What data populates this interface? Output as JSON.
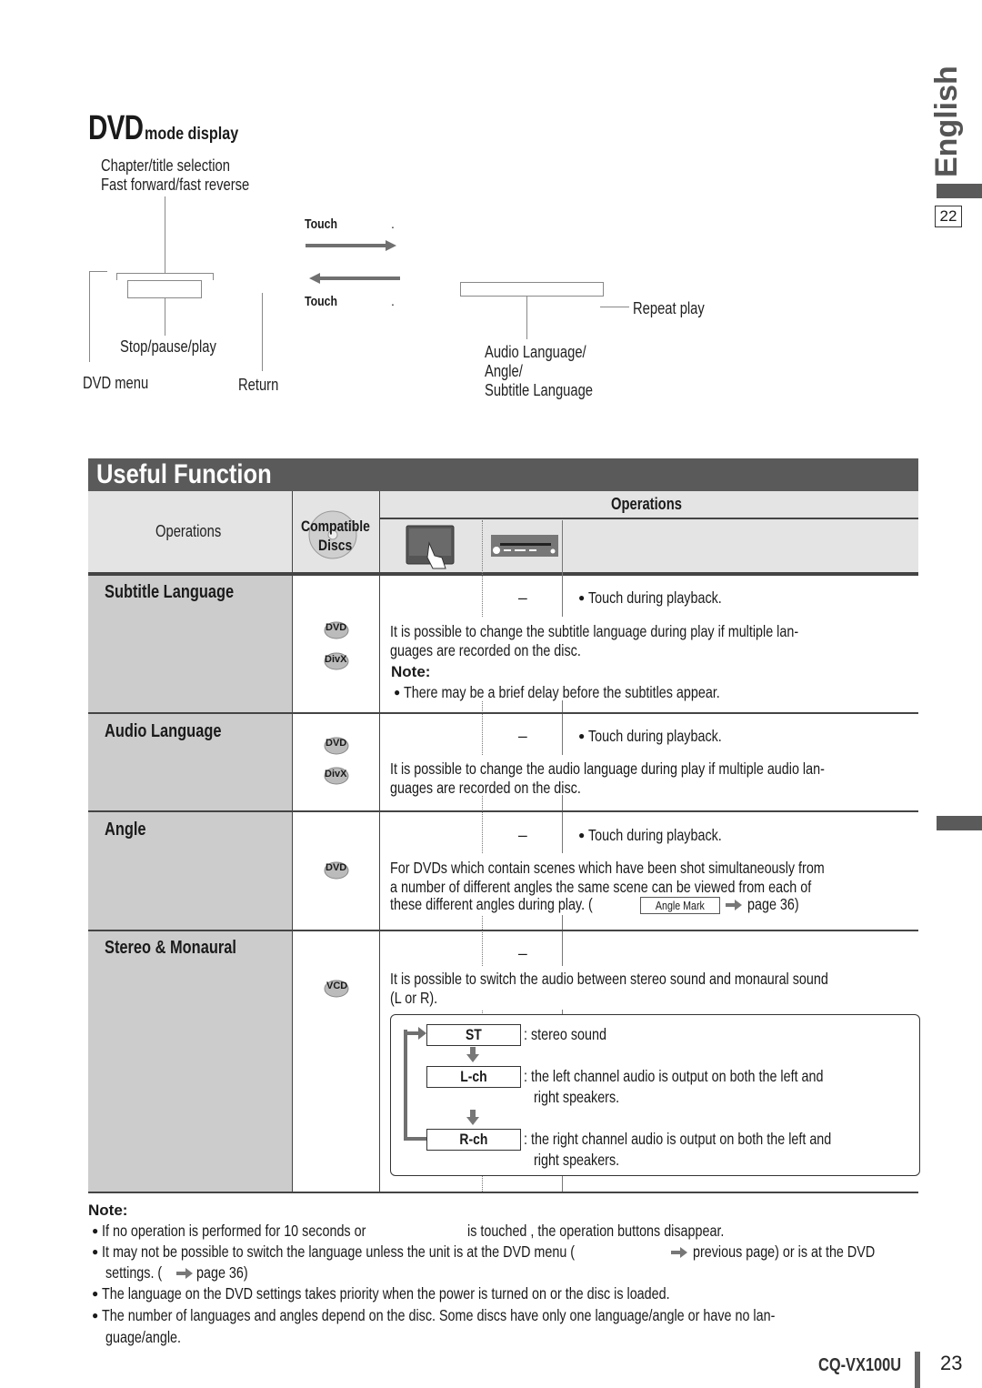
{
  "side_tab": {
    "language": "English",
    "page_ref": "22"
  },
  "dvd_mode_display": {
    "title_big": "DVD",
    "title_small": "mode display",
    "labels": {
      "chapter_title": "Chapter/title selection",
      "fast_forward": "Fast forward/fast reverse",
      "stop_pause_play": "Stop/pause/play",
      "dvd_menu": "DVD menu",
      "return": "Return",
      "repeat_play": "Repeat play",
      "audio_lang": "Audio Language/",
      "angle": "Angle/",
      "subtitle_lang": "Subtitle Language"
    },
    "touch_top": "Touch",
    "touch_top_suffix": ".",
    "touch_bottom": "Touch",
    "touch_bottom_suffix": "."
  },
  "useful_function": {
    "header": "Useful Function",
    "table_header": {
      "operations_left": "Operations",
      "compatible_discs_line1": "Compatible",
      "compatible_discs_line2": "Discs",
      "operations_right": "Operations",
      "touch_panel_icon": "touch-panel-icon",
      "unit_icon": "head-unit-icon"
    },
    "rows": [
      {
        "title": "Subtitle Language",
        "discs": [
          "DVD",
          "DivX"
        ],
        "unit_op": "–",
        "touch_op": "Touch during playback.",
        "desc1": "It is possible to change the subtitle language during play if multiple lan-",
        "desc2": "guages are recorded on the disc.",
        "note_label": "Note:",
        "note": "There may be a brief delay before the subtitles appear."
      },
      {
        "title": "Audio Language",
        "discs": [
          "DVD",
          "DivX"
        ],
        "unit_op": "–",
        "touch_op": "Touch during playback.",
        "desc1": "It is possible to change the audio language during play if multiple audio lan-",
        "desc2": "guages are recorded on the disc."
      },
      {
        "title": "Angle",
        "discs": [
          "DVD"
        ],
        "unit_op": "–",
        "touch_op": "Touch during playback.",
        "desc1": "For DVDs which contain scenes which have been shot simultaneously from",
        "desc2": "a number of different angles the same scene can be viewed from each of",
        "desc3": "these different angles during play. (",
        "angle_mark": "Angle Mark",
        "page_ref": "page 36)"
      },
      {
        "title": "Stereo & Monaural",
        "discs": [
          "VCD"
        ],
        "unit_op": "–",
        "desc1": "It is possible to switch the audio between stereo sound and monaural sound",
        "desc2": "(L or R).",
        "modes": [
          {
            "label": "ST",
            "desc1": ": stereo sound",
            "desc2": ""
          },
          {
            "label": "L-ch",
            "desc1": ": the left channel audio is output on both the left and",
            "desc2": "right speakers."
          },
          {
            "label": "R-ch",
            "desc1": ": the right channel audio is output on both the left and",
            "desc2": "right speakers."
          }
        ]
      }
    ]
  },
  "notes": {
    "heading": "Note:",
    "items": [
      {
        "a": "If no operation is performed for 10 seconds or",
        "b": "is touched , the operation buttons disappear."
      },
      {
        "a": "It may not be possible to switch the language unless the unit is at the DVD menu (",
        "b": "previous page) or is at the DVD"
      },
      {
        "a": "settings. (",
        "b": "page 36)"
      },
      {
        "a": "The language on the DVD settings takes priority when the power is turned on or the disc is loaded."
      },
      {
        "a": "The number of languages and angles depend on the disc. Some discs have only one language/angle or have no lan-"
      },
      {
        "a": "guage/angle."
      }
    ]
  },
  "footer": {
    "model": "CQ-VX100U",
    "page": "23"
  },
  "colors": {
    "header_bg": "#5a5a5a",
    "label_bg": "#cccccc",
    "thead_bg": "#e4e4e4",
    "arrow": "#707070"
  }
}
